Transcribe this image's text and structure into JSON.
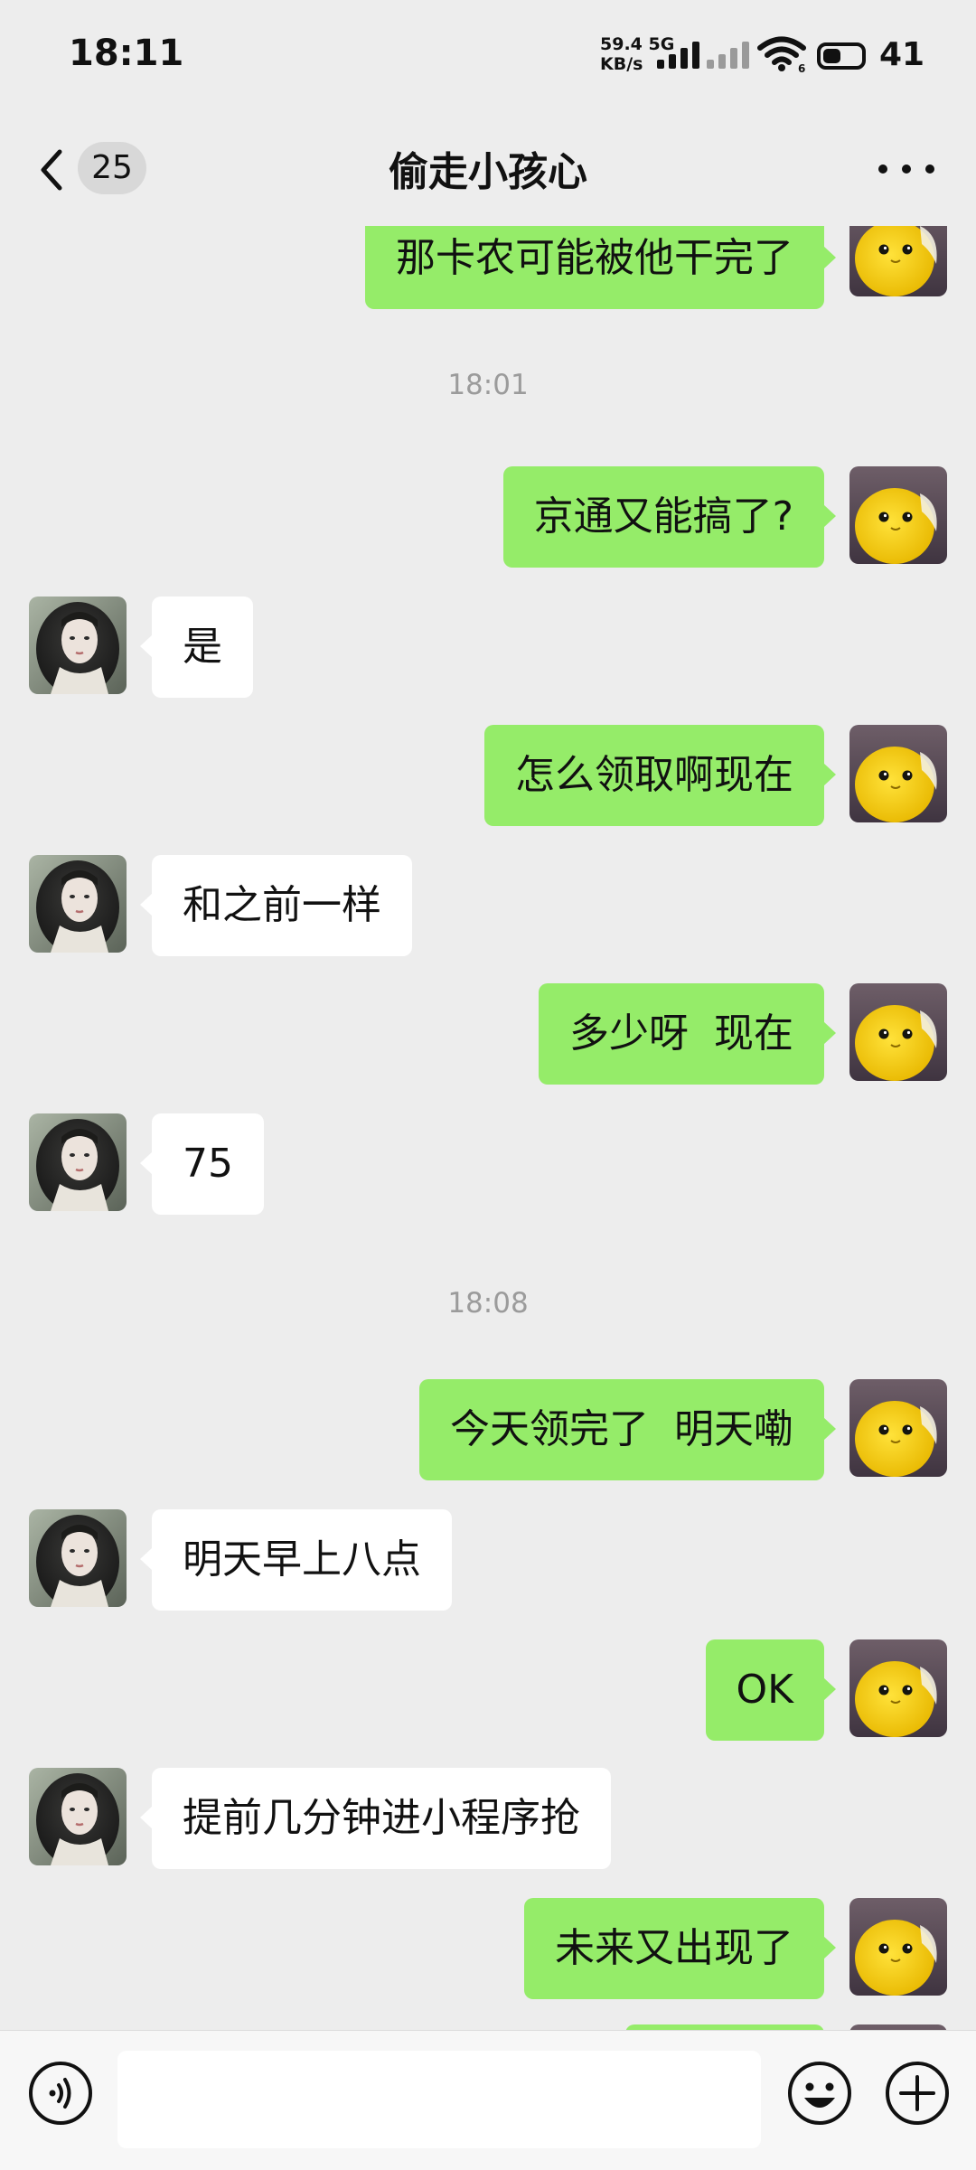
{
  "status_bar": {
    "time": "18:11",
    "net_speed_value": "59.4",
    "net_speed_unit": "KB/s",
    "network_type": "5G",
    "sim2_label": "6",
    "battery_level": "41"
  },
  "nav": {
    "unread_count": "25",
    "title": "偷走小孩心"
  },
  "messages": [
    {
      "from": "me",
      "text": "那卡农可能被他干完了"
    },
    {
      "type": "time",
      "text": "18:01"
    },
    {
      "from": "me",
      "text": "京通又能搞了?"
    },
    {
      "from": "them",
      "text": "是"
    },
    {
      "from": "me",
      "text": "怎么领取啊现在"
    },
    {
      "from": "them",
      "text": "和之前一样"
    },
    {
      "from": "me",
      "text": "多少呀  现在"
    },
    {
      "from": "them",
      "text": "75"
    },
    {
      "type": "time",
      "text": "18:08"
    },
    {
      "from": "me",
      "text": "今天领完了  明天嘞"
    },
    {
      "from": "them",
      "text": "明天早上八点"
    },
    {
      "from": "me",
      "text": "OK"
    },
    {
      "from": "them",
      "text": "提前几分钟进小程序抢"
    },
    {
      "from": "me",
      "text": "未来又出现了"
    }
  ],
  "input_bar": {
    "icons": [
      "voice-icon",
      "emoji-icon",
      "plus-icon"
    ]
  },
  "colors": {
    "background": "#ededed",
    "my_bubble": "#95ec69",
    "their_bubble": "#ffffff",
    "timestamp": "#9b9b9b"
  }
}
